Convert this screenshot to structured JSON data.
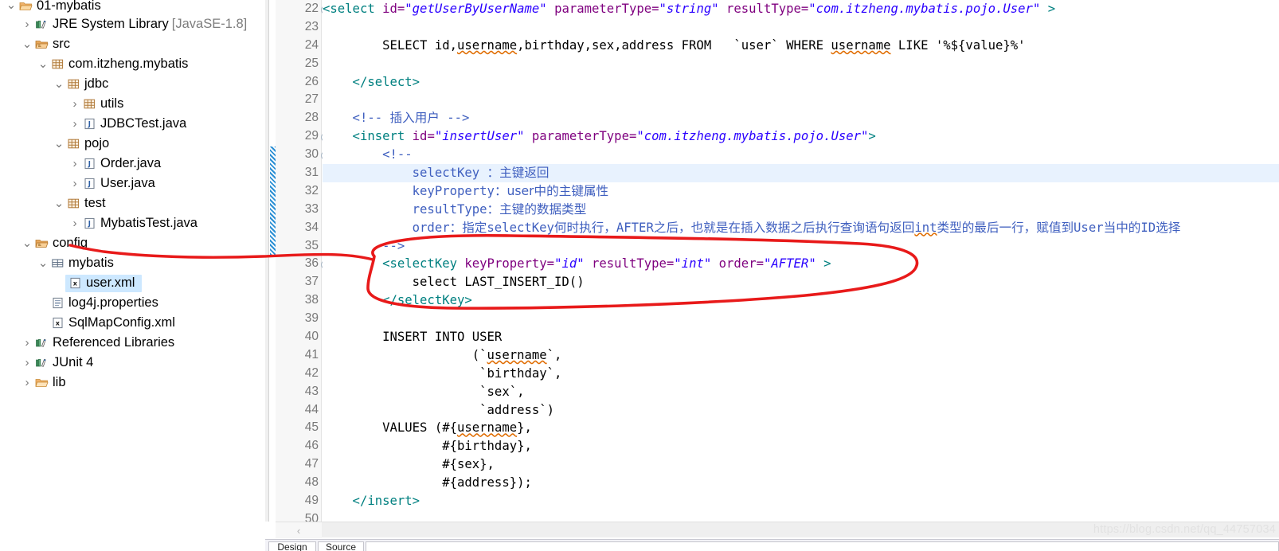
{
  "explorer": {
    "name": "package-explorer",
    "items": [
      {
        "indent": 0,
        "twisty": "v",
        "icon": "project-folder-icon",
        "label": "01-mybatis",
        "suffix": "",
        "selected": false,
        "clipped_top": true
      },
      {
        "indent": 1,
        "twisty": ">",
        "icon": "library-icon",
        "label": "JRE System Library",
        "suffix": "[JavaSE-1.8]",
        "selected": false
      },
      {
        "indent": 1,
        "twisty": "v",
        "icon": "source-folder-icon",
        "label": "src",
        "suffix": "",
        "selected": false
      },
      {
        "indent": 2,
        "twisty": "v",
        "icon": "package-icon",
        "label": "com.itzheng.mybatis",
        "suffix": "",
        "selected": false
      },
      {
        "indent": 3,
        "twisty": "v",
        "icon": "package-icon",
        "label": "jdbc",
        "suffix": "",
        "selected": false
      },
      {
        "indent": 4,
        "twisty": ">",
        "icon": "package-icon",
        "label": "utils",
        "suffix": "",
        "selected": false
      },
      {
        "indent": 4,
        "twisty": ">",
        "icon": "java-file-icon",
        "label": "JDBCTest.java",
        "suffix": "",
        "selected": false
      },
      {
        "indent": 3,
        "twisty": "v",
        "icon": "package-icon",
        "label": "pojo",
        "suffix": "",
        "selected": false
      },
      {
        "indent": 4,
        "twisty": ">",
        "icon": "java-file-icon",
        "label": "Order.java",
        "suffix": "",
        "selected": false
      },
      {
        "indent": 4,
        "twisty": ">",
        "icon": "java-file-icon",
        "label": "User.java",
        "suffix": "",
        "selected": false
      },
      {
        "indent": 3,
        "twisty": "v",
        "icon": "package-icon",
        "label": "test",
        "suffix": "",
        "selected": false
      },
      {
        "indent": 4,
        "twisty": ">",
        "icon": "java-file-icon",
        "label": "MybatisTest.java",
        "suffix": "",
        "selected": false
      },
      {
        "indent": 1,
        "twisty": "v",
        "icon": "source-folder-icon",
        "label": "config",
        "suffix": "",
        "selected": false
      },
      {
        "indent": 2,
        "twisty": "v",
        "icon": "package-folder-icon",
        "label": "mybatis",
        "suffix": "",
        "selected": false
      },
      {
        "indent": 3,
        "twisty": "",
        "icon": "xml-file-icon",
        "label": "user.xml",
        "suffix": "",
        "selected": true
      },
      {
        "indent": 2,
        "twisty": "",
        "icon": "properties-file-icon",
        "label": "log4j.properties",
        "suffix": "",
        "selected": false
      },
      {
        "indent": 2,
        "twisty": "",
        "icon": "xml-file-icon",
        "label": "SqlMapConfig.xml",
        "suffix": "",
        "selected": false
      },
      {
        "indent": 1,
        "twisty": ">",
        "icon": "library-icon",
        "label": "Referenced Libraries",
        "suffix": "",
        "selected": false
      },
      {
        "indent": 1,
        "twisty": ">",
        "icon": "library-icon",
        "label": "JUnit 4",
        "suffix": "",
        "selected": false
      },
      {
        "indent": 1,
        "twisty": ">",
        "icon": "folder-icon",
        "label": "lib",
        "suffix": "",
        "selected": false
      }
    ]
  },
  "editor": {
    "name": "xml-source-editor",
    "first_line_number": 22,
    "last_line_number": 50,
    "highlighted_line": 31,
    "change_bar_lines": [
      30,
      35
    ],
    "fold_lines": [
      22,
      29,
      30,
      36
    ],
    "watermark": "https://blog.csdn.net/qq_44757034",
    "scroll_left_arrow": "‹",
    "lines": [
      {
        "n": 22,
        "fold": true,
        "indent": 8,
        "tokens": [
          {
            "t": "tag",
            "s": "<select "
          },
          {
            "t": "attr",
            "s": "id="
          },
          {
            "t": "val",
            "s": "\"getUserByUserName\""
          },
          {
            "t": "plain",
            "s": " "
          },
          {
            "t": "attr",
            "s": "parameterType="
          },
          {
            "t": "val",
            "s": "\"string\""
          },
          {
            "t": "plain",
            "s": " "
          },
          {
            "t": "attr",
            "s": "resultType="
          },
          {
            "t": "val",
            "s": "\"com.itzheng.mybatis.pojo.User\""
          },
          {
            "t": "plain",
            "s": " "
          },
          {
            "t": "tag",
            "s": ">"
          }
        ]
      },
      {
        "n": 23,
        "fold": false,
        "indent": 0,
        "tokens": []
      },
      {
        "n": 24,
        "fold": false,
        "indent": 0,
        "tokens": [
          {
            "t": "plain",
            "s": "        SELECT id,"
          },
          {
            "t": "sq",
            "s": "username"
          },
          {
            "t": "plain",
            "s": ",birthday,sex,address FROM   `user` WHERE "
          },
          {
            "t": "sq",
            "s": "username"
          },
          {
            "t": "plain",
            "s": " LIKE '%${value}%'"
          }
        ]
      },
      {
        "n": 25,
        "fold": false,
        "indent": 0,
        "tokens": []
      },
      {
        "n": 26,
        "fold": false,
        "indent": 0,
        "tokens": [
          {
            "t": "tag",
            "s": "    </select>"
          }
        ]
      },
      {
        "n": 27,
        "fold": false,
        "indent": 0,
        "tokens": []
      },
      {
        "n": 28,
        "fold": false,
        "indent": 0,
        "tokens": [
          {
            "t": "cmt",
            "s": "    <!-- "
          },
          {
            "t": "cmt-cjk",
            "s": "插入用户"
          },
          {
            "t": "cmt",
            "s": " -->"
          }
        ]
      },
      {
        "n": 29,
        "fold": true,
        "indent": 0,
        "tokens": [
          {
            "t": "tag",
            "s": "    <insert "
          },
          {
            "t": "attr",
            "s": "id="
          },
          {
            "t": "val",
            "s": "\"insertUser\""
          },
          {
            "t": "plain",
            "s": " "
          },
          {
            "t": "attr",
            "s": "parameterType="
          },
          {
            "t": "val",
            "s": "\"com.itzheng.mybatis.pojo.User\""
          },
          {
            "t": "tag",
            "s": ">"
          }
        ]
      },
      {
        "n": 30,
        "fold": true,
        "indent": 0,
        "tokens": [
          {
            "t": "cmt",
            "s": "        <!--"
          }
        ]
      },
      {
        "n": 31,
        "fold": false,
        "indent": 0,
        "tokens": [
          {
            "t": "cmt",
            "s": "            selectKey "
          },
          {
            "t": "cmt-cjk",
            "s": "：主键返回"
          }
        ]
      },
      {
        "n": 32,
        "fold": false,
        "indent": 0,
        "tokens": [
          {
            "t": "cmt",
            "s": "            keyProperty"
          },
          {
            "t": "cmt-cjk",
            "s": "：user中的主键属性"
          }
        ]
      },
      {
        "n": 33,
        "fold": false,
        "indent": 0,
        "tokens": [
          {
            "t": "cmt",
            "s": "            resultType"
          },
          {
            "t": "cmt-cjk",
            "s": "：主键的数据类型"
          }
        ]
      },
      {
        "n": 34,
        "fold": false,
        "indent": 0,
        "tokens": [
          {
            "t": "cmt",
            "s": "            order"
          },
          {
            "t": "cmt-cjk",
            "s": "：指定"
          },
          {
            "t": "cmt",
            "s": "selectKey"
          },
          {
            "t": "cmt-cjk",
            "s": "何时执行，"
          },
          {
            "t": "cmt",
            "s": "AFTER"
          },
          {
            "t": "cmt-cjk",
            "s": "之后，也就是在插入数据之后执行查询语句返回"
          },
          {
            "t": "cmt-sq",
            "s": "int"
          },
          {
            "t": "cmt-cjk",
            "s": "类型的最后一行，赋值到"
          },
          {
            "t": "cmt",
            "s": "User"
          },
          {
            "t": "cmt-cjk",
            "s": "当中的"
          },
          {
            "t": "cmt",
            "s": "ID"
          },
          {
            "t": "cmt-cjk",
            "s": "选择"
          }
        ]
      },
      {
        "n": 35,
        "fold": false,
        "indent": 0,
        "tokens": [
          {
            "t": "cmt",
            "s": "        -->"
          }
        ]
      },
      {
        "n": 36,
        "fold": true,
        "indent": 0,
        "tokens": [
          {
            "t": "tag",
            "s": "        <selectKey "
          },
          {
            "t": "attr",
            "s": "keyProperty="
          },
          {
            "t": "val",
            "s": "\"id\""
          },
          {
            "t": "plain",
            "s": " "
          },
          {
            "t": "attr",
            "s": "resultType="
          },
          {
            "t": "val",
            "s": "\"int\""
          },
          {
            "t": "plain",
            "s": " "
          },
          {
            "t": "attr",
            "s": "order="
          },
          {
            "t": "val",
            "s": "\"AFTER\""
          },
          {
            "t": "plain",
            "s": " "
          },
          {
            "t": "tag",
            "s": ">"
          }
        ]
      },
      {
        "n": 37,
        "fold": false,
        "indent": 0,
        "tokens": [
          {
            "t": "plain",
            "s": "            select LAST_INSERT_ID()"
          }
        ]
      },
      {
        "n": 38,
        "fold": false,
        "indent": 0,
        "tokens": [
          {
            "t": "tag",
            "s": "        </selectKey>"
          }
        ]
      },
      {
        "n": 39,
        "fold": false,
        "indent": 0,
        "tokens": []
      },
      {
        "n": 40,
        "fold": false,
        "indent": 0,
        "tokens": [
          {
            "t": "plain",
            "s": "        INSERT INTO USER"
          }
        ]
      },
      {
        "n": 41,
        "fold": false,
        "indent": 0,
        "tokens": [
          {
            "t": "plain",
            "s": "                    (`"
          },
          {
            "t": "sq",
            "s": "username"
          },
          {
            "t": "plain",
            "s": "`,"
          }
        ]
      },
      {
        "n": 42,
        "fold": false,
        "indent": 0,
        "tokens": [
          {
            "t": "plain",
            "s": "                     `birthday`,"
          }
        ]
      },
      {
        "n": 43,
        "fold": false,
        "indent": 0,
        "tokens": [
          {
            "t": "plain",
            "s": "                     `sex`,"
          }
        ]
      },
      {
        "n": 44,
        "fold": false,
        "indent": 0,
        "tokens": [
          {
            "t": "plain",
            "s": "                     `address`)"
          }
        ]
      },
      {
        "n": 45,
        "fold": false,
        "indent": 0,
        "tokens": [
          {
            "t": "plain",
            "s": "        VALUES (#{"
          },
          {
            "t": "sq",
            "s": "username"
          },
          {
            "t": "plain",
            "s": "},"
          }
        ]
      },
      {
        "n": 46,
        "fold": false,
        "indent": 0,
        "tokens": [
          {
            "t": "plain",
            "s": "                #{birthday},"
          }
        ]
      },
      {
        "n": 47,
        "fold": false,
        "indent": 0,
        "tokens": [
          {
            "t": "plain",
            "s": "                #{sex},"
          }
        ]
      },
      {
        "n": 48,
        "fold": false,
        "indent": 0,
        "tokens": [
          {
            "t": "plain",
            "s": "                #{address});"
          }
        ]
      },
      {
        "n": 49,
        "fold": false,
        "indent": 0,
        "tokens": [
          {
            "t": "tag",
            "s": "    </insert>"
          }
        ]
      },
      {
        "n": 50,
        "fold": false,
        "indent": 0,
        "tokens": []
      }
    ]
  },
  "bottom_tabs": {
    "name": "editor-view-tabs",
    "tabs": [
      {
        "label": "Design"
      },
      {
        "label": "Source"
      }
    ]
  },
  "annotation": {
    "name": "red-handdrawn-annotation",
    "color": "#e81a1a",
    "description": "hand-drawn red ellipse around lines 36-38 with a leader line pointing to user.xml in the tree"
  },
  "colors": {
    "tag": "#008080",
    "attribute": "#7f007f",
    "value": "#2a00ff",
    "comment": "#3f5fbf",
    "selection": "#cde8ff",
    "current_line": "#e8f2fe",
    "annotation_red": "#e81a1a",
    "watermark": "#e2e2e2"
  }
}
